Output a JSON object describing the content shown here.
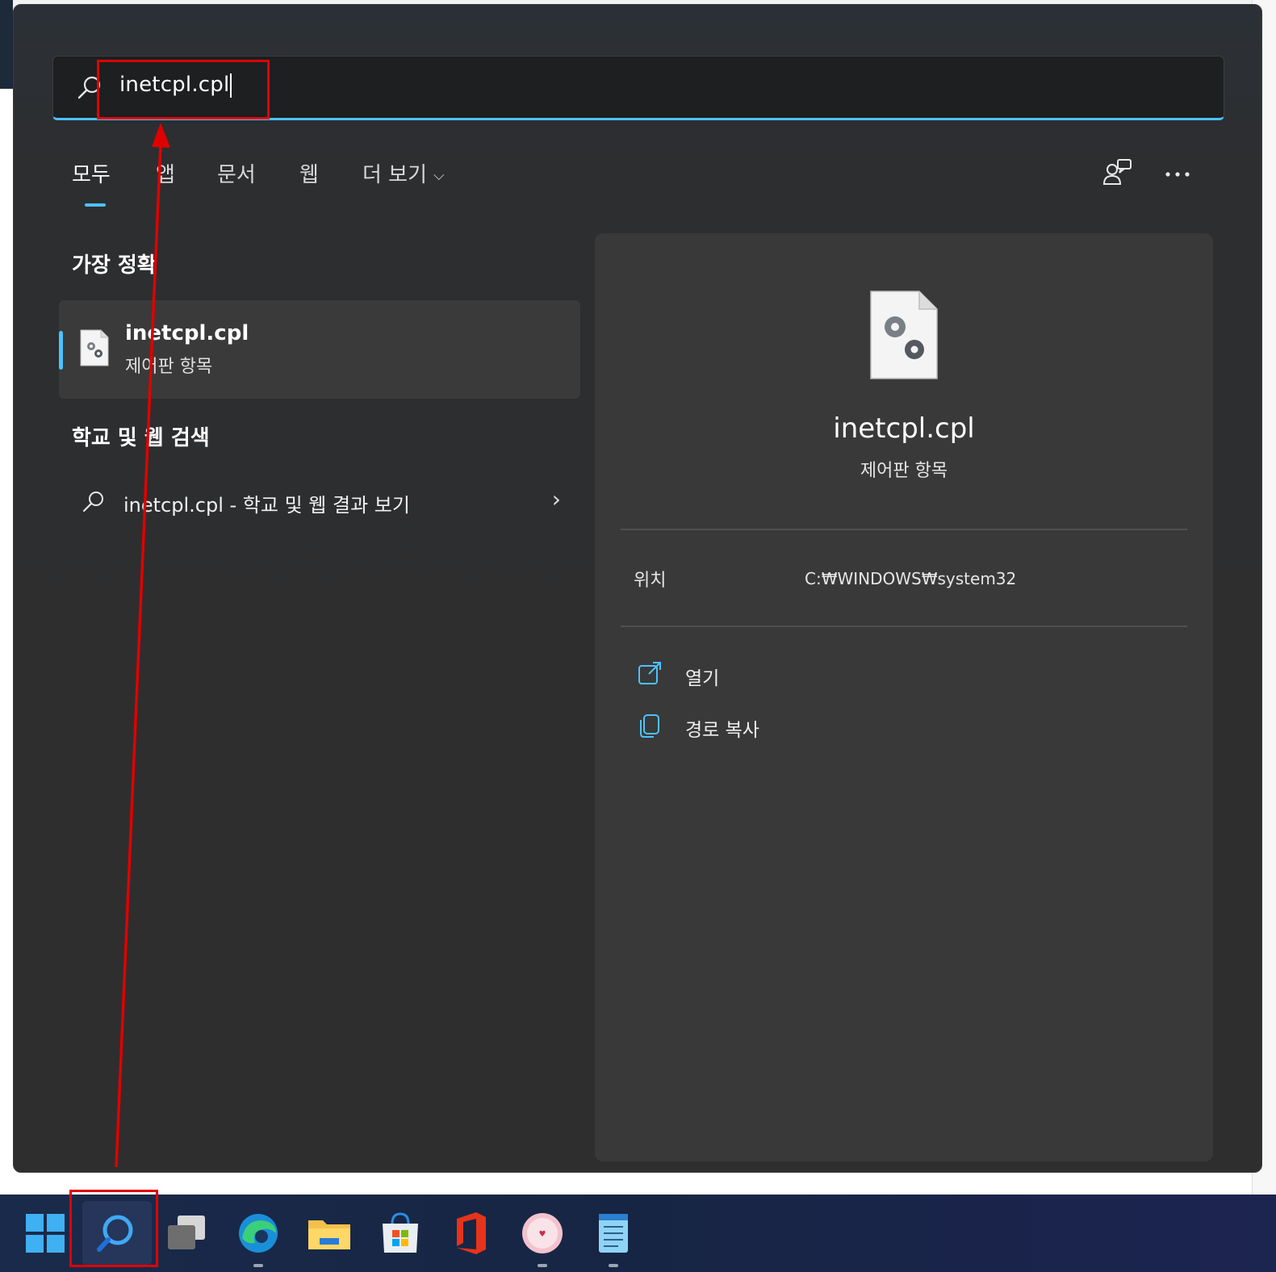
{
  "search": {
    "query": "inetcpl.cpl"
  },
  "tabs": [
    {
      "label": "모두"
    },
    {
      "label": "앱"
    },
    {
      "label": "문서"
    },
    {
      "label": "웹"
    },
    {
      "label": "더 보기"
    }
  ],
  "sections": {
    "best_match_title": "가장 정확",
    "web_search_title": "학교 및 웹 검색"
  },
  "best_match": {
    "name": "inetcpl.cpl",
    "type": "제어판 항목"
  },
  "web_result": {
    "text": "inetcpl.cpl - 학교 및 웹 결과 보기"
  },
  "preview": {
    "title": "inetcpl.cpl",
    "subtitle": "제어판 항목",
    "location_label": "위치",
    "location_value": "C:₩WINDOWS₩system32",
    "actions": [
      {
        "label": "열기",
        "icon": "open-external-icon"
      },
      {
        "label": "경로 복사",
        "icon": "copy-icon"
      }
    ]
  },
  "taskbar": {
    "items": [
      {
        "icon": "windows-start-icon"
      },
      {
        "icon": "search-icon"
      },
      {
        "icon": "task-view-icon"
      },
      {
        "icon": "edge-icon"
      },
      {
        "icon": "file-explorer-icon"
      },
      {
        "icon": "microsoft-store-icon"
      },
      {
        "icon": "office-icon"
      },
      {
        "icon": "app-pink-icon"
      },
      {
        "icon": "notepad-icon"
      }
    ]
  },
  "colors": {
    "accent": "#4cc2ff",
    "annotation": "#e00000",
    "panel": "#2e2e2e",
    "preview": "#393939"
  }
}
